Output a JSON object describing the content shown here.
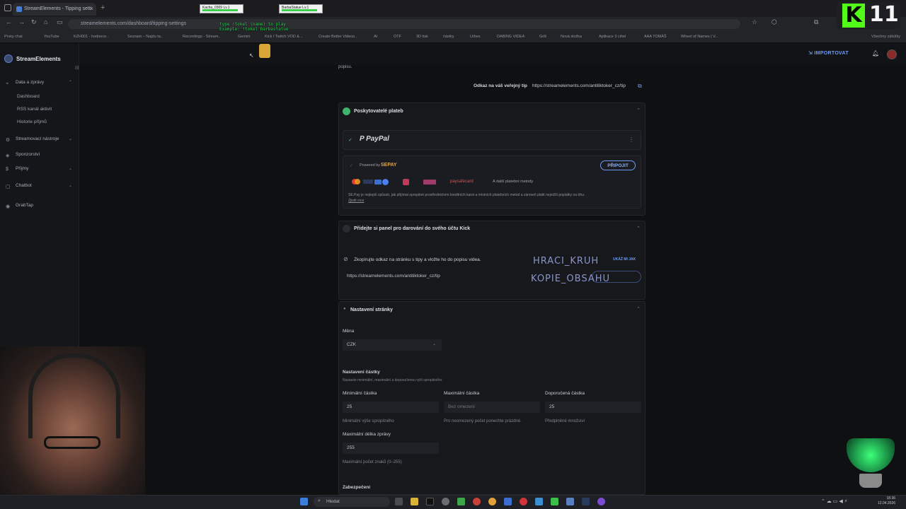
{
  "browser": {
    "tab_title": "StreamElements - Tipping setti",
    "url": "streamelements.com/dashboard/tipping-settings",
    "bookmarks": [
      "Prvky chat",
      "YouTube",
      "KZH001 - hodnoce..",
      "Seznam – Najdu ta..",
      "Recordings - Stream..",
      "Gemini",
      "Kick / Twitch VOD & ..",
      "Create Better Videos..",
      "AI",
      "OTF",
      "3D tisk",
      "částky",
      "Urbex",
      "DABING VIDEA",
      "Grill",
      "Nová složka",
      "Aplikace 3 cihel",
      "AAA TOMÁŠ",
      "Wheel of Names | V..."
    ],
    "bookmarks_right": "Všechny záložky"
  },
  "stream_overlay": {
    "badge1": "Kacha_0309 Lv.1",
    "badge2": "BarbaStatue Lv.1",
    "cmd_lines": [
      "type !tokel (name) to play",
      "Example: !tokel barbastatue"
    ],
    "kick_letter": "K",
    "kick_count": "11"
  },
  "app": {
    "brand": "StreamElements",
    "import_label": "IMPORTOVAT",
    "sidebar": {
      "data_group": "Data a zprávy",
      "data_items": [
        "Dashboard",
        "RSS kanál aktivit",
        "Historie příjmů"
      ],
      "items": [
        {
          "label": "Streamovací nástroje",
          "chevron": true
        },
        {
          "label": "Sponzorství",
          "chevron": false
        },
        {
          "label": "Příjmy",
          "chevron": true
        },
        {
          "label": "Chatbot",
          "chevron": true
        },
        {
          "label": "GrabTap",
          "chevron": false
        }
      ]
    }
  },
  "main": {
    "top_cut_text": "popisu.",
    "public_link_label": "Odkaz na váš veřejný tip",
    "public_link_url": "https://streamelements.com/antitiktoker_cz/tip",
    "providers": {
      "title": "Poskytovatelé plateb",
      "paypal": "PayPal",
      "powered_by": "Powered by",
      "sepay": "SEPAY",
      "connect_label": "PŘIPOJIT",
      "methods_suffix": "A další platební metody",
      "paysafe": "paysafecard",
      "description": "SE.Pay je nejlepší způsob, jak přijímat spropitné prostřednictvím kreditních karet a místních platebních metod a zároveň platit nejnižší poplatky na trhu.",
      "learn_more": "Zjistit více"
    },
    "kick_panel": {
      "title": "Přidejte si panel pro darování do svého účtu Kick",
      "instruction": "Zkopírujte odkaz na stránku s tipy a vložte ho do popisu videa.",
      "show_me": "UKÁŽ MI JAK",
      "link": "https://streamelements.com/antitiktoker_cz/tip",
      "overlay_text_1": "HRACI_KRUH",
      "overlay_text_2": "KOPIE_OBSAHU"
    },
    "page_settings": {
      "title": "Nastavení stránky",
      "currency_label": "Měna",
      "currency_value": "CZK",
      "amount_section": "Nastavení částky",
      "amount_hint": "Nastavte minimální, maximální a doporučenou výši spropitného",
      "min_label": "Minimální částka",
      "min_value": "25",
      "min_hint": "Minimální výše spropitného",
      "max_label": "Maximální částka",
      "max_placeholder": "Bez omezení",
      "max_hint": "Pro neomezený počet ponechte prázdné.",
      "rec_label": "Doporučená částka",
      "rec_value": "25",
      "rec_hint": "Předplněné množství",
      "msg_len_label": "Maximální délka zprávy",
      "msg_len_value": "255",
      "msg_len_hint": "Maximální počet znaků (0–255)",
      "security_label": "Zabezpečení"
    }
  },
  "taskbar": {
    "search_label": "Hledat",
    "time": "18:36",
    "date": "12.04.2026"
  }
}
